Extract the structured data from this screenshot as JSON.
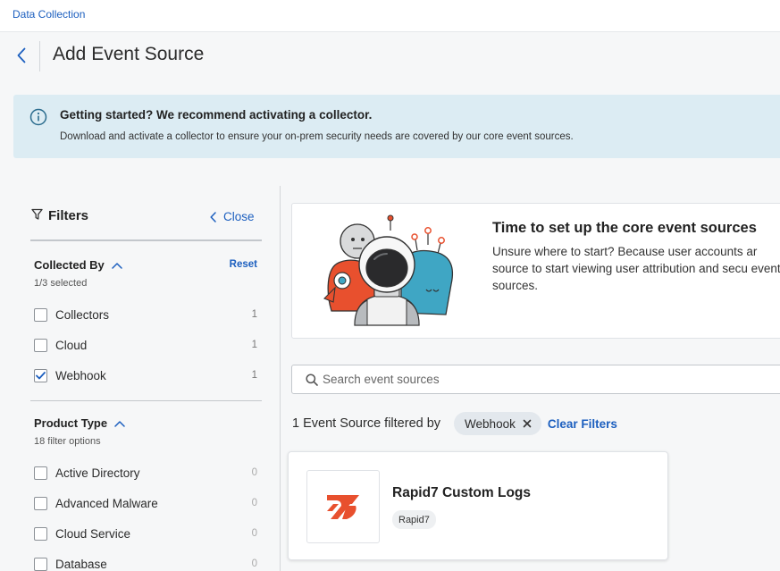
{
  "breadcrumb": "Data Collection",
  "page_title": "Add Event Source",
  "banner": {
    "title": "Getting started? We recommend activating a collector.",
    "text": "Download and activate a collector to ensure your on-prem security needs are covered by our core event sources."
  },
  "filters": {
    "title": "Filters",
    "close_label": "Close",
    "collected_by": {
      "title": "Collected By",
      "subtitle": "1/3 selected",
      "reset_label": "Reset",
      "options": [
        {
          "label": "Collectors",
          "count": "1",
          "checked": false
        },
        {
          "label": "Cloud",
          "count": "1",
          "checked": false
        },
        {
          "label": "Webhook",
          "count": "1",
          "checked": true
        }
      ]
    },
    "product_type": {
      "title": "Product Type",
      "subtitle": "18 filter options",
      "options": [
        {
          "label": "Active Directory",
          "count": "0",
          "checked": false
        },
        {
          "label": "Advanced Malware",
          "count": "0",
          "checked": false
        },
        {
          "label": "Cloud Service",
          "count": "0",
          "checked": false
        },
        {
          "label": "Database",
          "count": "0",
          "checked": false
        }
      ]
    }
  },
  "promo": {
    "title": "Time to set up the core event sources",
    "text": "Unsure where to start? Because user accounts ar source to start viewing user attribution and secu event sources."
  },
  "search": {
    "placeholder": "Search event sources"
  },
  "results": {
    "count_text": "1 Event Source filtered by",
    "chip_label": "Webhook",
    "clear_label": "Clear Filters"
  },
  "card": {
    "title": "Rapid7 Custom Logs",
    "tag": "Rapid7"
  },
  "colors": {
    "link_blue": "#1c5fbf",
    "banner_bg": "#dcecf3",
    "rapid7_orange": "#e8502e",
    "robot_red": "#e8502e",
    "robot_teal": "#3fa6c4"
  },
  "icons": [
    "back-chevron-icon",
    "info-icon",
    "filter-icon",
    "chevron-left-icon",
    "chevron-up-icon",
    "check-icon",
    "search-icon",
    "close-x-icon",
    "rapid7-logo-icon"
  ]
}
